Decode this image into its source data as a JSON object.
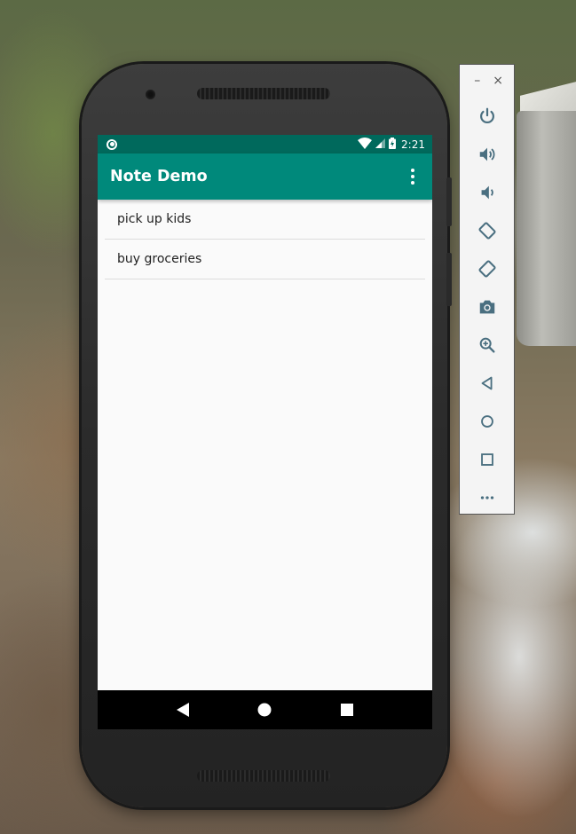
{
  "status_bar": {
    "time": "2:21"
  },
  "app_bar": {
    "title": "Note Demo"
  },
  "notes": [
    {
      "text": "pick up kids"
    },
    {
      "text": "buy groceries"
    }
  ],
  "emulator_toolbar": {
    "minimize_label": "–",
    "close_label": "×",
    "buttons": [
      "power-icon",
      "volume-up-icon",
      "volume-down-icon",
      "rotate-left-icon",
      "rotate-right-icon",
      "screenshot-camera-icon",
      "zoom-icon",
      "back-icon",
      "home-icon",
      "overview-icon",
      "more-icon"
    ]
  },
  "colors": {
    "primary": "#00897b",
    "primary_dark": "#00695c",
    "toolbar_icon": "#4a6f80"
  }
}
